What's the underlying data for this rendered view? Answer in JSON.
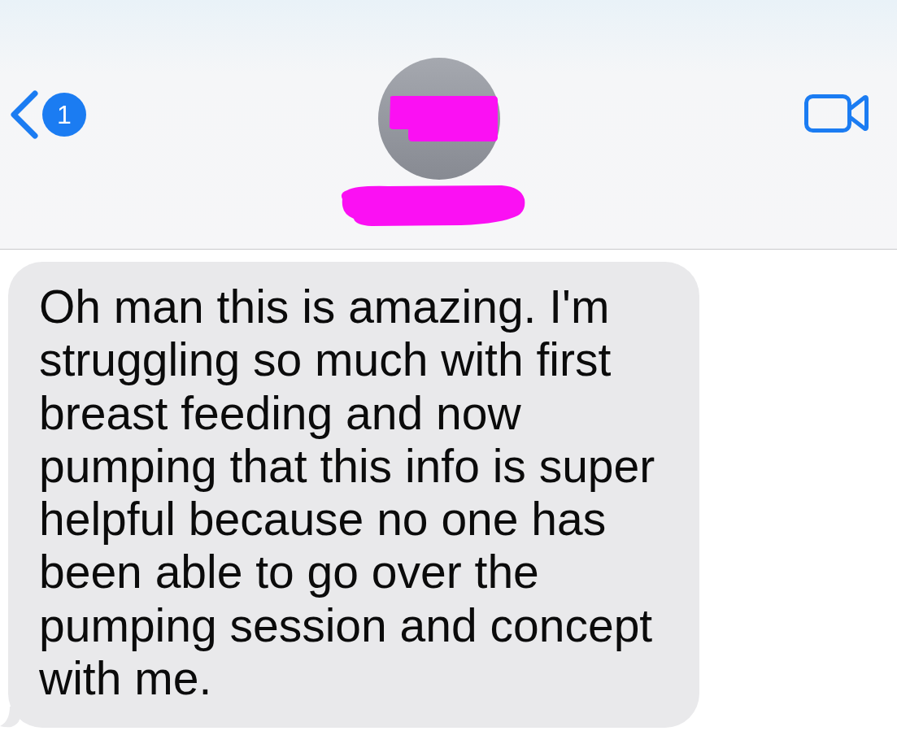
{
  "header": {
    "back_badge": "1",
    "avatar_redacted": true,
    "name_redacted": true
  },
  "messages": [
    {
      "kind": "incoming",
      "text": "Oh man this is amazing. I'm struggling so much with first breast feeding and now pumping that this info is super helpful because no one has been able to go over the pumping session and concept with me."
    }
  ]
}
